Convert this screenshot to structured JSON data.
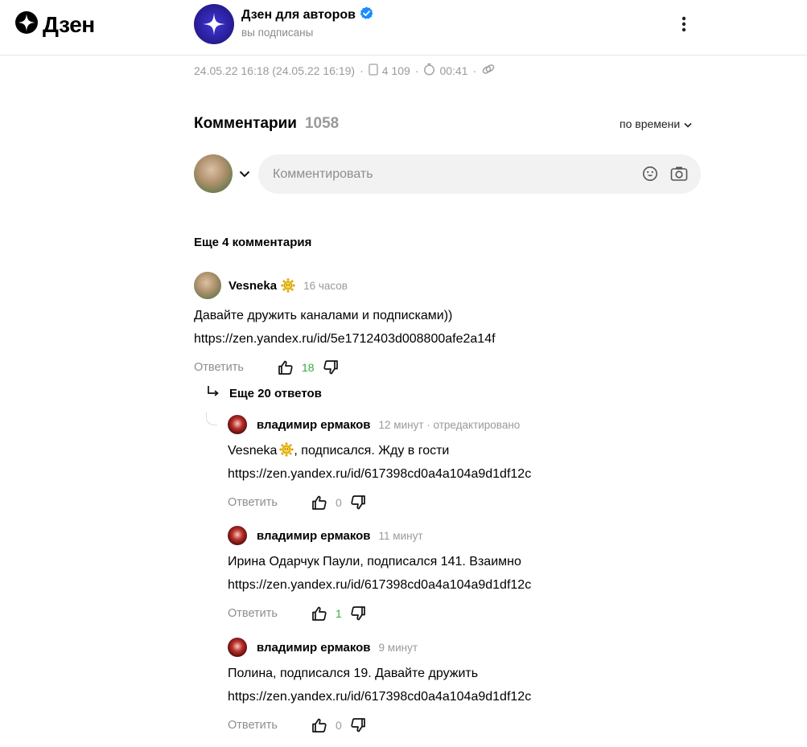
{
  "header": {
    "logo_text": "Дзен",
    "channel_name": "Дзен для авторов",
    "channel_status": "вы подписаны"
  },
  "meta": {
    "date": "24.05.22 16:18 (24.05.22 16:19)",
    "reads": "4 109",
    "read_time": "00:41"
  },
  "comments_section": {
    "title": "Комментарии",
    "count": "1058",
    "sort_label": "по времени",
    "input_placeholder": "Комментировать",
    "more_comments": "Еще 4 комментария"
  },
  "comments": [
    {
      "author": "Vesneka",
      "time": "16 часов",
      "lines": [
        "Давайте дружить каналами и подписками))",
        "https://zen.yandex.ru/id/5e1712403d008800afe2a14f"
      ],
      "reply_label": "Ответить",
      "likes": "18"
    }
  ],
  "answers_link": "Еще 20 ответов",
  "replies": [
    {
      "author": "владимир ермаков",
      "time": "12 минут · отредактировано",
      "mention": "Vesneka",
      "line1_rest": ", подписался. Жду в гости",
      "line2": "https://zen.yandex.ru/id/617398cd0a4a104a9d1df12c",
      "reply_label": "Ответить",
      "likes": "0"
    },
    {
      "author": "владимир ермаков",
      "time": "11 минут",
      "line1": "Ирина Одарчук Паули, подписался 141. Взаимно",
      "line2": "https://zen.yandex.ru/id/617398cd0a4a104a9d1df12c",
      "reply_label": "Ответить",
      "likes": "1"
    },
    {
      "author": "владимир ермаков",
      "time": "9 минут",
      "line1": "Полина, подписался 19. Давайте дружить",
      "line2": "https://zen.yandex.ru/id/617398cd0a4a104a9d1df12c",
      "reply_label": "Ответить",
      "likes": "0"
    }
  ],
  "icons": {
    "logo": "zen-star-icon",
    "verified": "verified-check-icon",
    "menu": "more-vertical-icon",
    "badge": "sun-badge-icon",
    "like": "thumb-up-icon",
    "dislike": "thumb-down-icon",
    "emoji": "emoji-icon",
    "camera": "camera-icon"
  },
  "colors": {
    "accent_green": "#2eb03a",
    "verified_blue": "#1a8cff",
    "muted_text": "#9a9a9a",
    "input_bg": "#f2f2f2"
  }
}
